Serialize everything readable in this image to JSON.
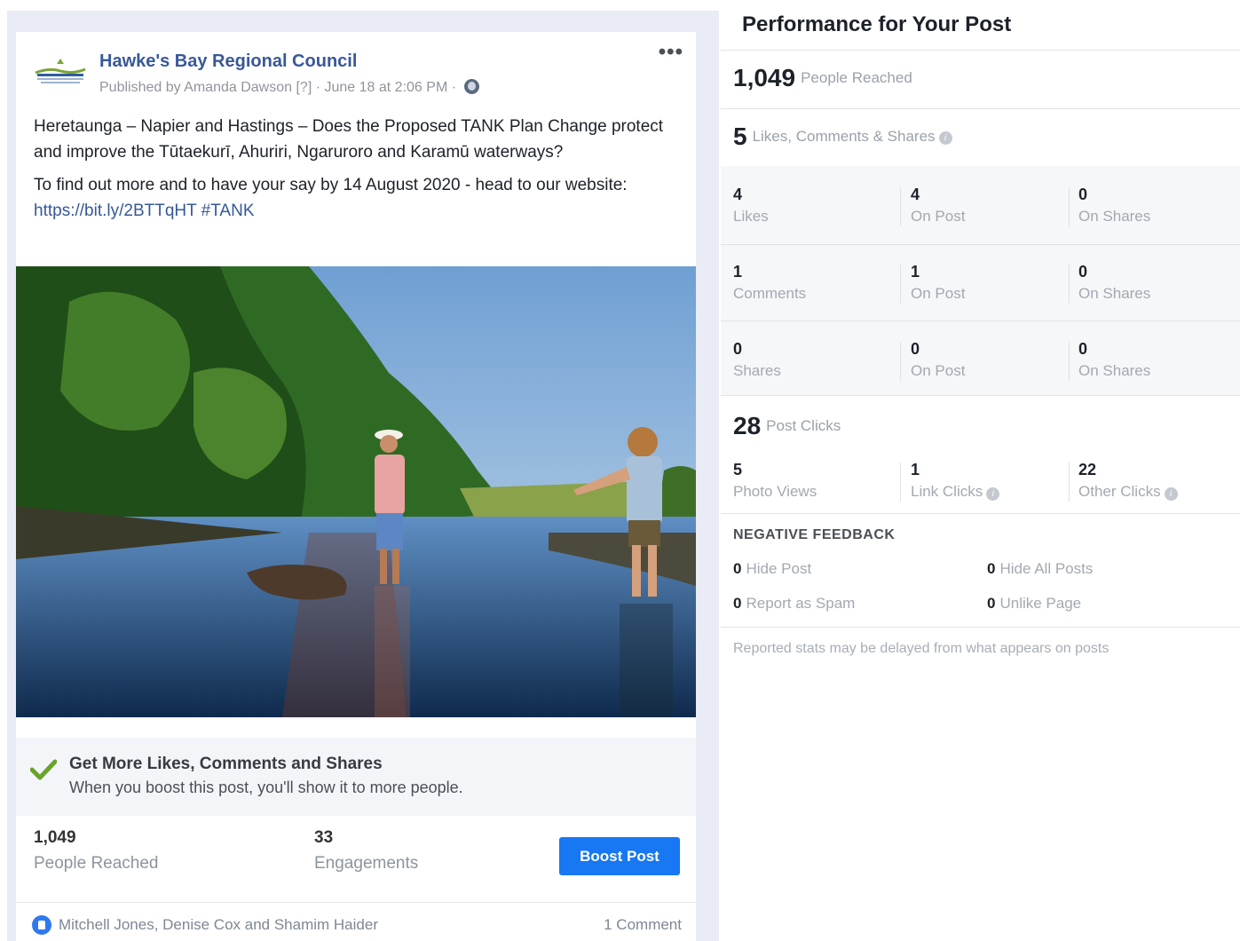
{
  "post": {
    "page_name": "Hawke's Bay Regional Council",
    "published_by": "Published by Amanda Dawson",
    "help_marker": "[?]",
    "date": "· June 18 at 2:06 PM ·",
    "more_label": "•••",
    "text_para1": "Heretaunga – Napier and Hastings – Does the Proposed TANK Plan Change protect and improve the Tūtaekurī, Ahuriri, Ngaruroro and Karamū waterways?",
    "text_para2_prefix": "To find out more and to have your say by 14 August 2020 - head to our website: ",
    "link_url": "https://bit.ly/2BTTqHT",
    "hashtag": "#TANK",
    "promo_title": "Get More Likes, Comments and Shares",
    "promo_sub": "When you boost this post, you'll show it to more people.",
    "reached_num": "1,049",
    "reached_label": "People Reached",
    "engagements_num": "33",
    "engagements_label": "Engagements",
    "boost_label": "Boost Post",
    "reactors": "Mitchell Jones, Denise Cox and Shamim Haider",
    "comment_count": "1 Comment",
    "photo_icon": "river-photo"
  },
  "performance": {
    "title": "Performance for Your Post",
    "reached_num": "1,049",
    "reached_label": "People Reached",
    "engagement_num": "5",
    "engagement_label": "Likes, Comments & Shares",
    "rows": [
      {
        "a_num": "4",
        "a_label": "Likes",
        "b_num": "4",
        "b_label": "On Post",
        "c_num": "0",
        "c_label": "On Shares"
      },
      {
        "a_num": "1",
        "a_label": "Comments",
        "b_num": "1",
        "b_label": "On Post",
        "c_num": "0",
        "c_label": "On Shares"
      },
      {
        "a_num": "0",
        "a_label": "Shares",
        "b_num": "0",
        "b_label": "On Post",
        "c_num": "0",
        "c_label": "On Shares"
      }
    ],
    "clicks_num": "28",
    "clicks_label": "Post Clicks",
    "photo_views_num": "5",
    "photo_views_label": "Photo Views",
    "link_clicks_num": "1",
    "link_clicks_label": "Link Clicks",
    "other_clicks_num": "22",
    "other_clicks_label": "Other Clicks",
    "negative_title": "NEGATIVE FEEDBACK",
    "hide_post_num": "0",
    "hide_post_label": "Hide Post",
    "hide_all_num": "0",
    "hide_all_label": "Hide All Posts",
    "spam_num": "0",
    "spam_label": "Report as Spam",
    "unlike_num": "0",
    "unlike_label": "Unlike Page",
    "footnote": "Reported stats may be delayed from what appears on posts",
    "info_glyph": "i"
  },
  "colors": {
    "accent": "#1877f2",
    "link": "#365899",
    "page_bg": "#e9ebf5"
  }
}
